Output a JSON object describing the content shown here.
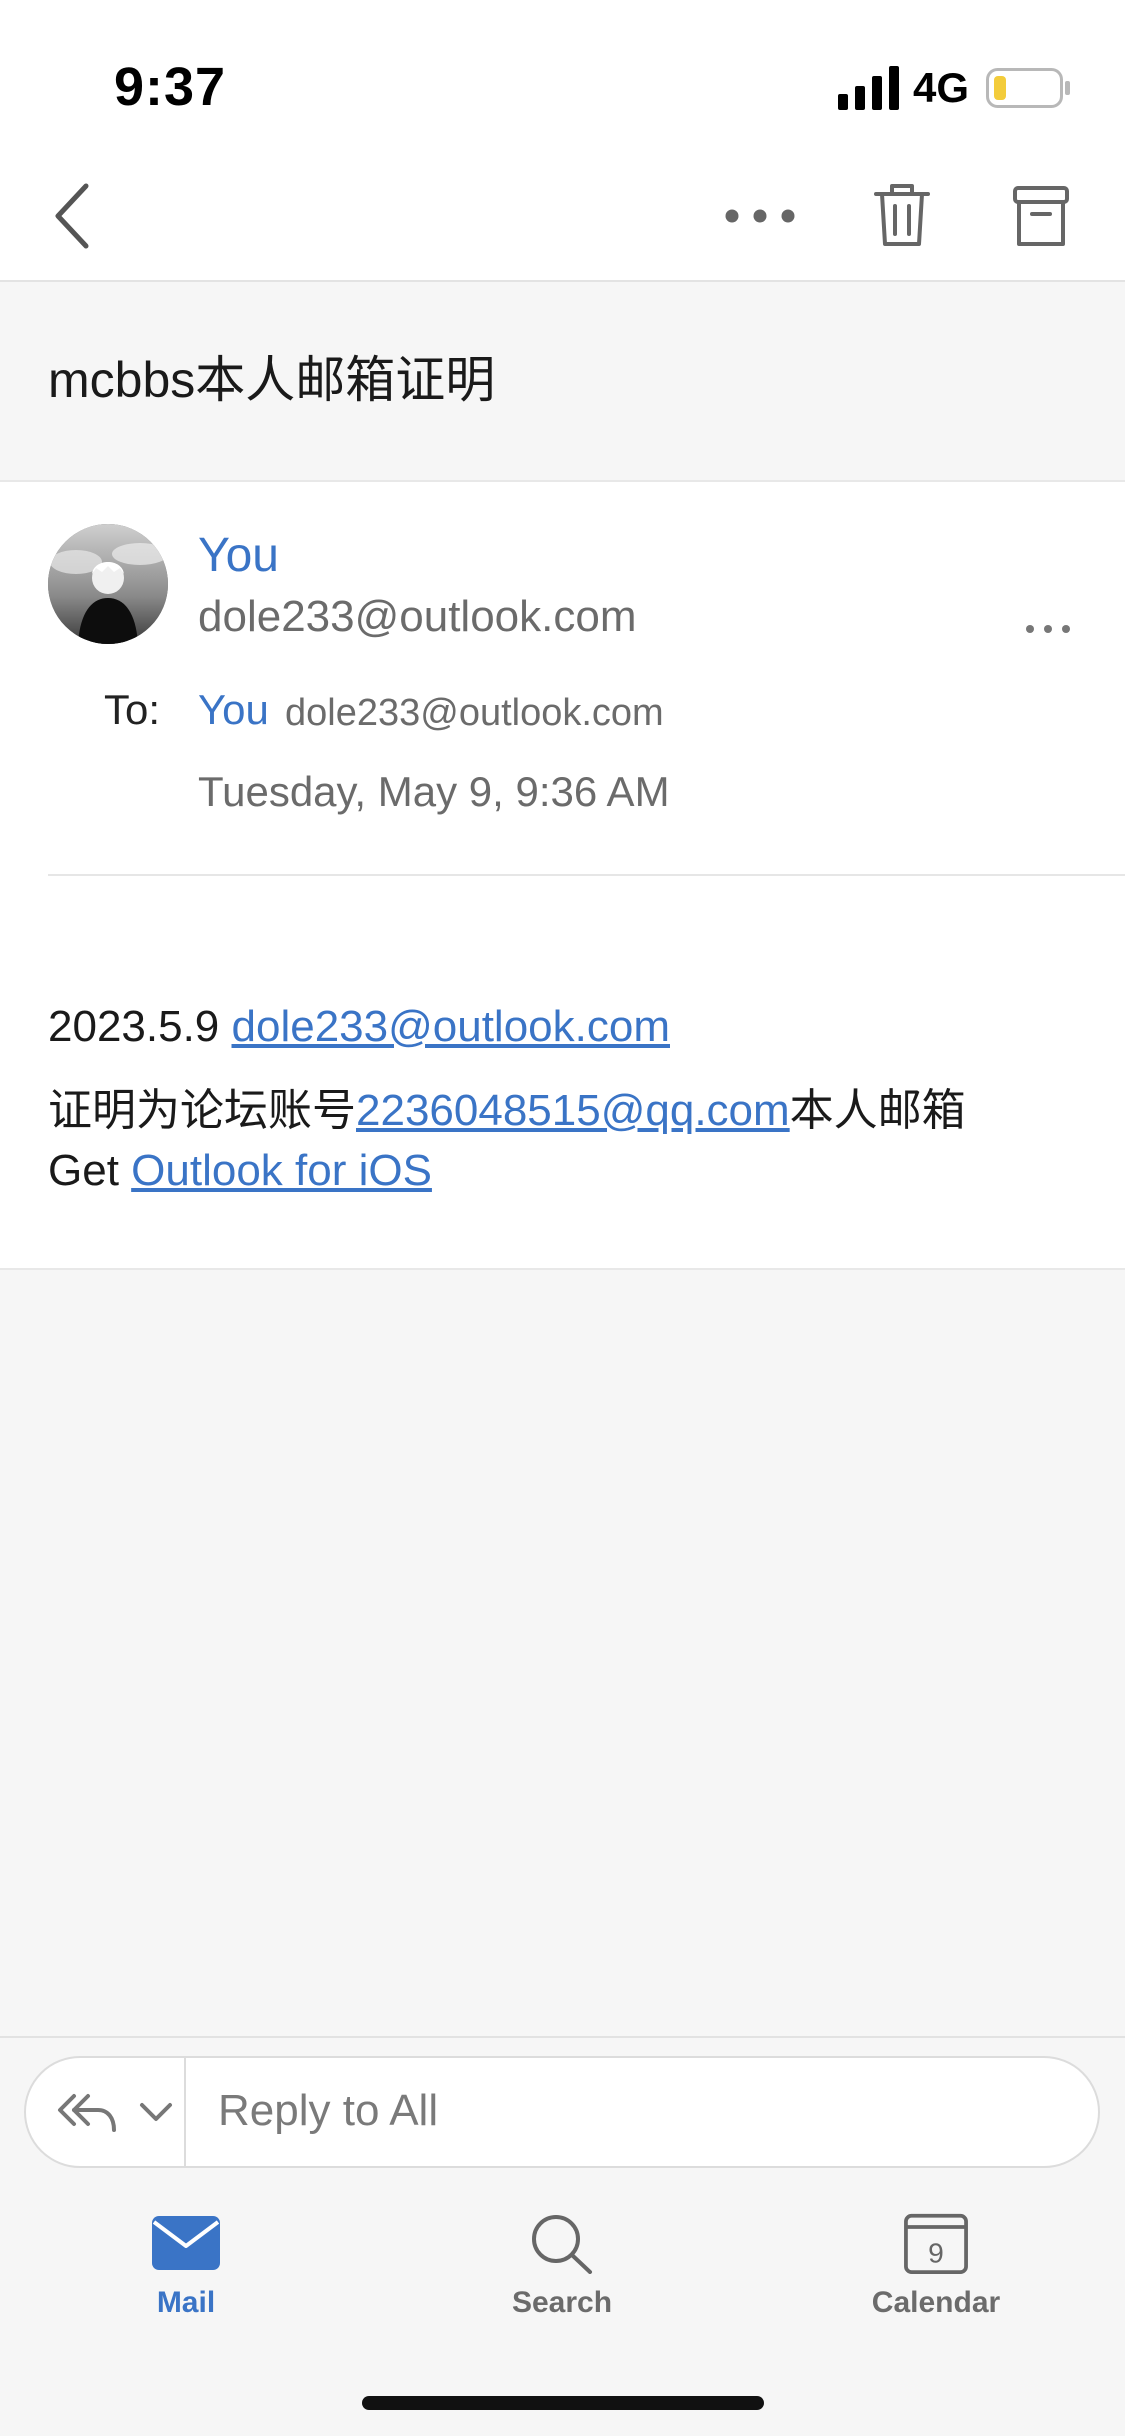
{
  "status_bar": {
    "time": "9:37",
    "network": "4G",
    "battery_color": "#f3cc3b"
  },
  "toolbar": {
    "back_icon": "chevron-left-icon",
    "more_icon": "ellipsis-icon",
    "delete_icon": "trash-icon",
    "archive_icon": "archive-box-icon"
  },
  "email": {
    "subject": "mcbbs本人邮箱证明",
    "sender": {
      "name": "You",
      "email": "dole233@outlook.com"
    },
    "to": {
      "label": "To:",
      "name": "You",
      "email": "dole233@outlook.com"
    },
    "date": "Tuesday, May 9, 9:36 AM",
    "body": {
      "line1_prefix": "2023.5.9 ",
      "line1_link": "dole233@outlook.com",
      "line2_prefix": "证明为论坛账号",
      "line2_link": "2236048515@qq.com",
      "line2_suffix": "本人邮箱",
      "line3_prefix": "Get ",
      "line3_link": "Outlook for iOS"
    }
  },
  "reply": {
    "placeholder": "Reply to All"
  },
  "tabs": [
    {
      "label": "Mail",
      "icon": "envelope-icon",
      "active": true
    },
    {
      "label": "Search",
      "icon": "search-icon",
      "active": false
    },
    {
      "label": "Calendar",
      "icon": "calendar-icon",
      "day": "9",
      "active": false
    }
  ],
  "colors": {
    "accent": "#3a74c6",
    "secondary_text": "#6b6b6b",
    "background": "#f6f6f6"
  }
}
